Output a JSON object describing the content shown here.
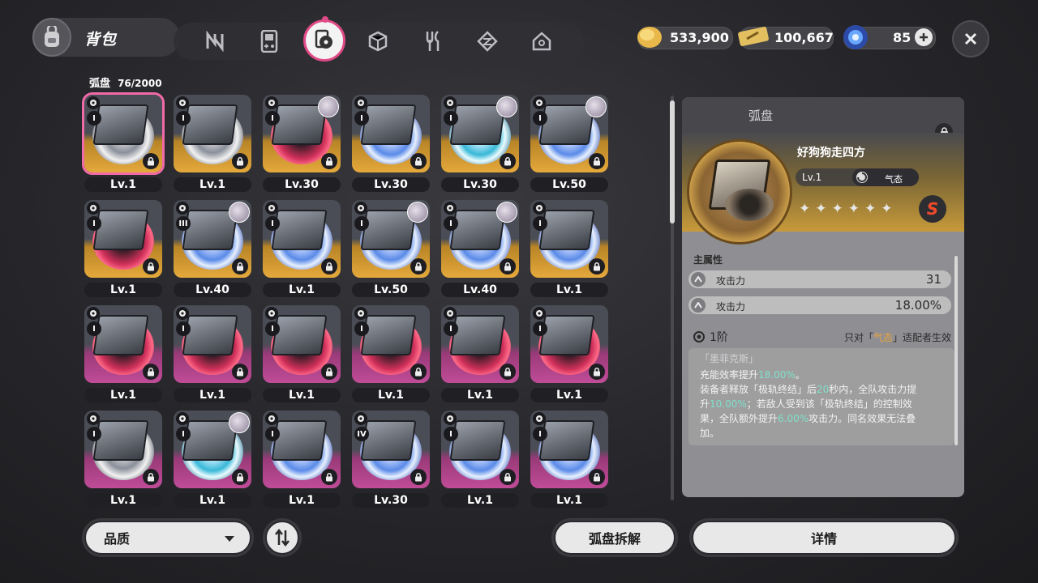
{
  "header": {
    "title": "背包"
  },
  "currency": {
    "gold": "533,900",
    "tickets": "100,667",
    "energy": "85"
  },
  "inventory": {
    "category": "弧盘",
    "count": "76/2000"
  },
  "grid": [
    {
      "lv": "Lv.1",
      "rank": "I",
      "frame": "gold",
      "disc": "swirl",
      "portrait": false,
      "selected": true
    },
    {
      "lv": "Lv.1",
      "rank": "I",
      "frame": "gold",
      "disc": "swirl",
      "portrait": false
    },
    {
      "lv": "Lv.30",
      "rank": "I",
      "frame": "gold",
      "disc": "red",
      "portrait": true
    },
    {
      "lv": "Lv.30",
      "rank": "I",
      "frame": "gold",
      "disc": "blue",
      "portrait": false
    },
    {
      "lv": "Lv.30",
      "rank": "I",
      "frame": "gold",
      "disc": "teal",
      "portrait": true
    },
    {
      "lv": "Lv.50",
      "rank": "I",
      "frame": "gold",
      "disc": "blue",
      "portrait": true
    },
    {
      "lv": "Lv.1",
      "rank": "I",
      "frame": "gold",
      "disc": "red",
      "portrait": false
    },
    {
      "lv": "Lv.40",
      "rank": "III",
      "frame": "gold",
      "disc": "blue",
      "portrait": true
    },
    {
      "lv": "Lv.1",
      "rank": "I",
      "frame": "gold",
      "disc": "blue",
      "portrait": false
    },
    {
      "lv": "Lv.50",
      "rank": "I",
      "frame": "gold",
      "disc": "blue",
      "portrait": true
    },
    {
      "lv": "Lv.40",
      "rank": "I",
      "frame": "gold",
      "disc": "blue",
      "portrait": true
    },
    {
      "lv": "Lv.1",
      "rank": "I",
      "frame": "gold",
      "disc": "blue",
      "portrait": false
    },
    {
      "lv": "Lv.1",
      "rank": "I",
      "frame": "pink",
      "disc": "red",
      "portrait": false
    },
    {
      "lv": "Lv.1",
      "rank": "I",
      "frame": "pink",
      "disc": "red",
      "portrait": false
    },
    {
      "lv": "Lv.1",
      "rank": "I",
      "frame": "pink",
      "disc": "red",
      "portrait": false
    },
    {
      "lv": "Lv.1",
      "rank": "I",
      "frame": "pink",
      "disc": "red",
      "portrait": false
    },
    {
      "lv": "Lv.1",
      "rank": "I",
      "frame": "pink",
      "disc": "red",
      "portrait": false
    },
    {
      "lv": "Lv.1",
      "rank": "I",
      "frame": "pink",
      "disc": "red",
      "portrait": false
    },
    {
      "lv": "Lv.1",
      "rank": "I",
      "frame": "pink",
      "disc": "swirl",
      "portrait": false
    },
    {
      "lv": "Lv.1",
      "rank": "I",
      "frame": "pink",
      "disc": "teal",
      "portrait": true
    },
    {
      "lv": "Lv.1",
      "rank": "I",
      "frame": "pink",
      "disc": "blue",
      "portrait": false
    },
    {
      "lv": "Lv.30",
      "rank": "IV",
      "frame": "pink",
      "disc": "blue",
      "portrait": false
    },
    {
      "lv": "Lv.1",
      "rank": "I",
      "frame": "pink",
      "disc": "blue",
      "portrait": false
    },
    {
      "lv": "Lv.1",
      "rank": "I",
      "frame": "pink",
      "disc": "blue",
      "portrait": false
    }
  ],
  "detail": {
    "category": "弧盘",
    "name": "好狗狗走四方",
    "level": "Lv.1",
    "attribute": "气态",
    "rarity": "S",
    "main_stat_title": "主属性",
    "stats": [
      {
        "label": "攻击力",
        "value": "31"
      },
      {
        "label": "攻击力",
        "value": "18.00%"
      }
    ],
    "tier": "1阶",
    "restriction_prefix": "只对「",
    "restriction_attr": "气态",
    "restriction_suffix": "」适配者生效",
    "set_name": "「墨菲克斯」",
    "desc": [
      [
        {
          "t": "充能效率提升"
        },
        {
          "t": "18.00%",
          "h": true
        },
        {
          "t": "。"
        }
      ],
      [
        {
          "t": "装备者释放「极轨终结」后"
        },
        {
          "t": "20",
          "h": true
        },
        {
          "t": "秒内，全队攻击力提"
        }
      ],
      [
        {
          "t": "升"
        },
        {
          "t": "10.00%",
          "h": true
        },
        {
          "t": "；若敌人受到该「极轨终结」的控制效"
        }
      ],
      [
        {
          "t": "果，全队额外提升"
        },
        {
          "t": "6.00%",
          "h": true
        },
        {
          "t": "攻击力。同名效果无法叠"
        }
      ],
      [
        {
          "t": "加。"
        }
      ]
    ]
  },
  "footer": {
    "sort_label": "品质",
    "dismantle": "弧盘拆解",
    "details": "详情"
  },
  "colors": {
    "accent_pink": "#e04a86",
    "highlight_green": "#7fe0c8",
    "attr_orange": "#e8a23c"
  }
}
